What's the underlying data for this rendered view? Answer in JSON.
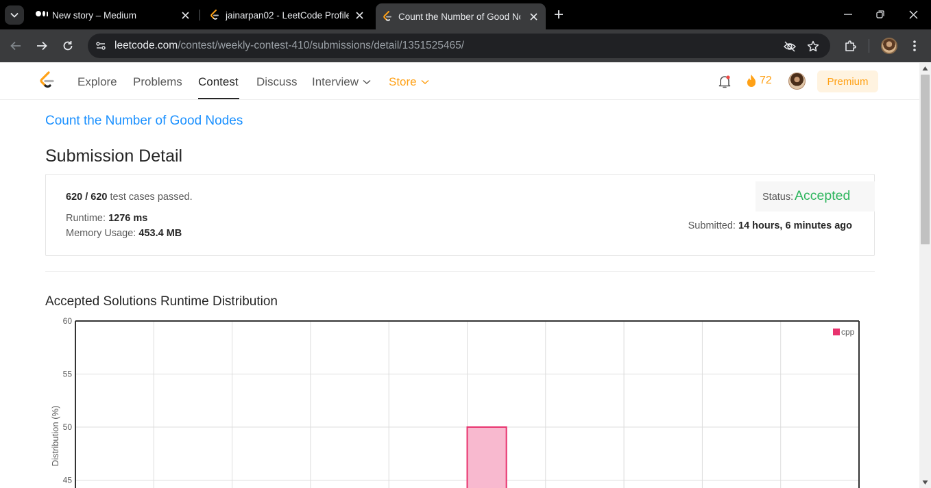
{
  "browser": {
    "tabs": [
      {
        "title": "New story – Medium",
        "icon": "medium-icon",
        "active": false
      },
      {
        "title": "jainarpan02 - LeetCode Profile",
        "icon": "leetcode-icon",
        "active": false
      },
      {
        "title": "Count the Number of Good No",
        "icon": "leetcode-icon",
        "active": true
      }
    ],
    "url_host": "leetcode.com",
    "url_path": "/contest/weekly-contest-410/submissions/detail/1351525465/"
  },
  "nav": {
    "items": [
      "Explore",
      "Problems",
      "Contest",
      "Discuss",
      "Interview",
      "Store"
    ],
    "active": "Contest",
    "streak": "72",
    "premium": "Premium"
  },
  "problem": {
    "title": "Count the Number of Good Nodes"
  },
  "submission": {
    "heading": "Submission Detail",
    "tests_passed": "620 / 620",
    "tests_suffix": "test cases passed.",
    "runtime_label": "Runtime:",
    "runtime_value": "1276 ms",
    "memory_label": "Memory Usage:",
    "memory_value": "453.4 MB",
    "status_label": "Status:",
    "status_value": "Accepted",
    "submitted_label": "Submitted:",
    "submitted_value": "14 hours, 6 minutes ago"
  },
  "distribution": {
    "title": "Accepted Solutions Runtime Distribution"
  },
  "colors": {
    "accent": "#ffa116",
    "link": "#1a90ff",
    "accepted": "#2db55d",
    "bar_fill": "#f8b9cf",
    "bar_stroke": "#e8336e"
  },
  "chart_data": {
    "type": "bar",
    "ylabel": "Distribution (%)",
    "yticks": [
      60,
      55,
      50,
      45
    ],
    "ylim_visible": [
      45,
      60
    ],
    "grid": true,
    "legend_position": "top-right",
    "series": [
      {
        "name": "cpp",
        "values": [
          null,
          null,
          null,
          null,
          null,
          50,
          null,
          null,
          null,
          null
        ]
      }
    ],
    "bins": 10
  }
}
